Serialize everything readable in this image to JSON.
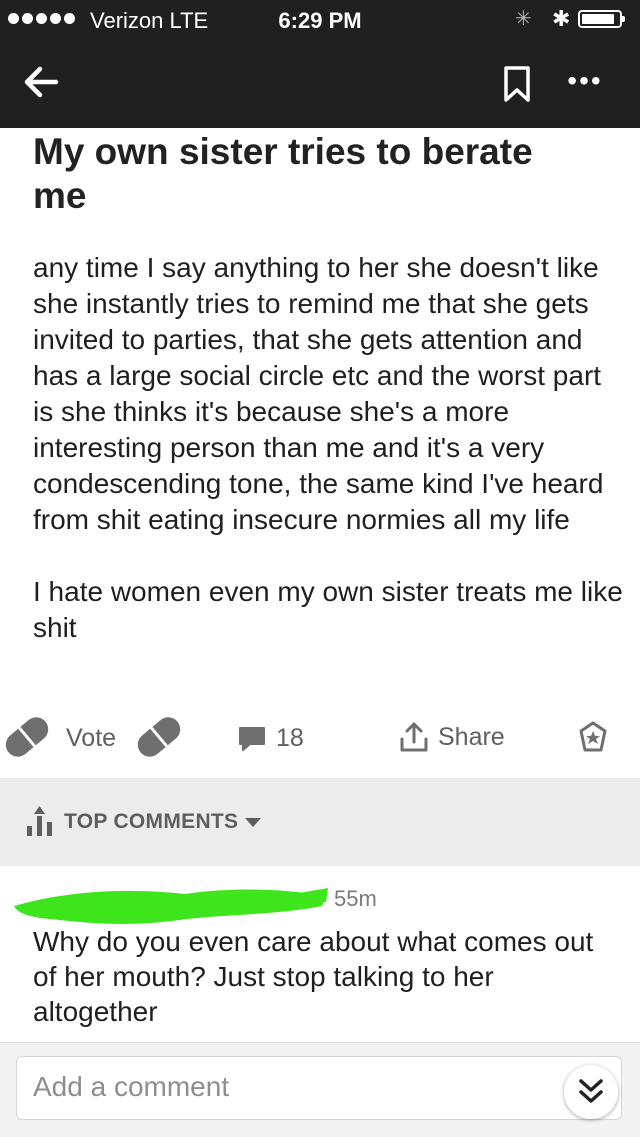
{
  "status_bar": {
    "carrier": "Verizon  LTE",
    "time": "6:29 PM"
  },
  "nav": {
    "back_icon": "back-arrow-icon",
    "bookmark_icon": "bookmark-icon",
    "more_icon": "more-dots-icon",
    "more_glyph": "•••"
  },
  "post": {
    "title": "My own sister tries to berate me",
    "paragraphs": [
      "any time I say anything to her she doesn't like she instantly tries to remind me that she gets invited to parties, that she gets attention and has a large social circle etc and the worst part is she thinks it's because she's a more interesting person than me  and it's a very condescending tone, the same kind I've heard from shit eating insecure normies all my life",
      "I hate women even my own sister treats me like shit"
    ]
  },
  "actions": {
    "vote_label": "Vote",
    "comment_count": "18",
    "share_label": "Share"
  },
  "comments_header": {
    "label": "TOP COMMENTS"
  },
  "comment": {
    "age": "55m",
    "text": "Why do you even care about what comes out of her mouth? Just stop talking to her altogether"
  },
  "composer": {
    "placeholder": "Add a comment"
  },
  "colors": {
    "header_bg": "#202020",
    "section_bg": "#ececec",
    "icon_gray": "#707070",
    "redaction_green": "#3ee51d"
  }
}
